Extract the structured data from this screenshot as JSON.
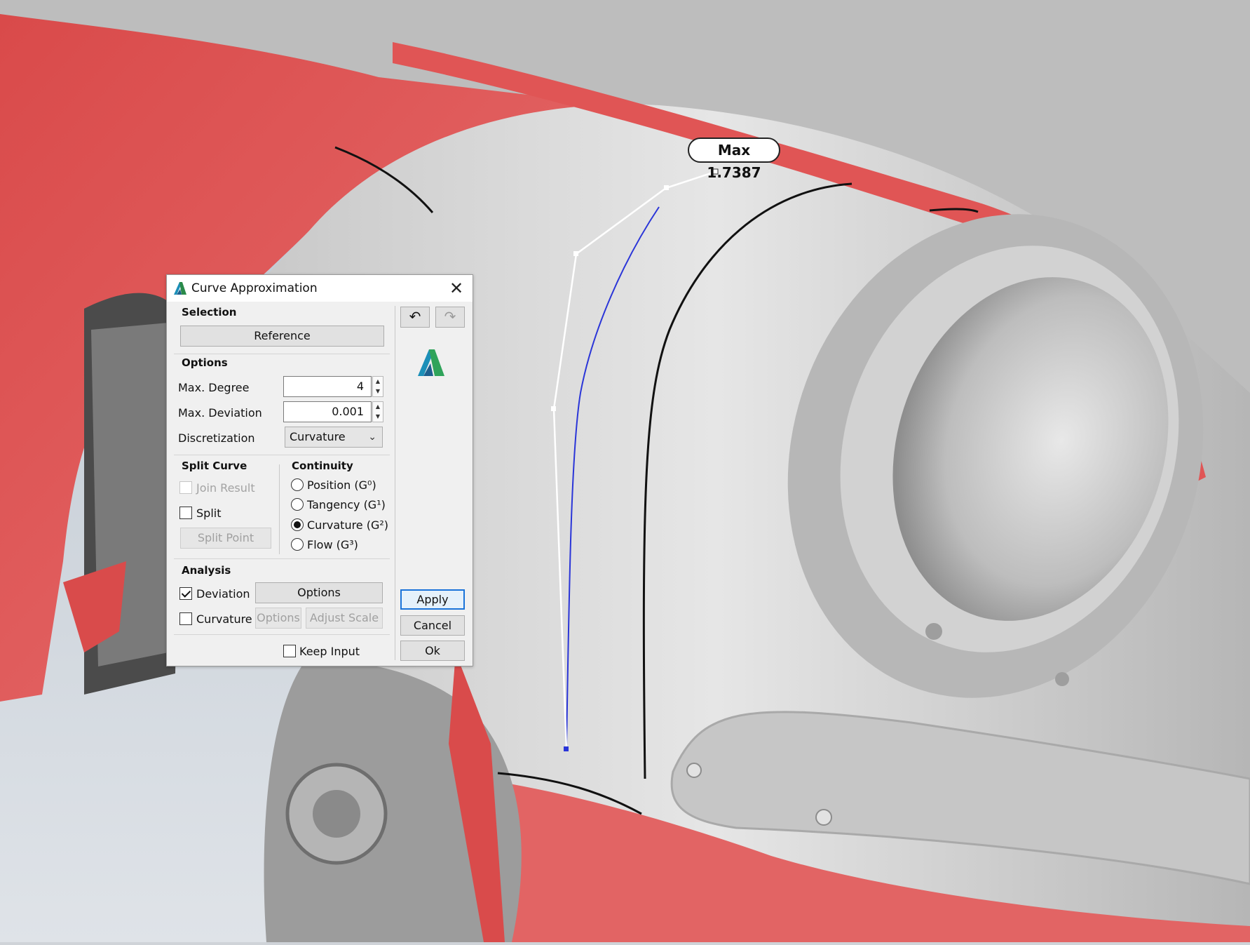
{
  "viewport": {
    "annotation": "Max 1.7387",
    "accent_red": "#e04b4b",
    "surface_gray": "#c9c9c9"
  },
  "dialog": {
    "title": "Curve Approximation",
    "app_icon": "autodesk-logo-icon",
    "close_icon": "close-icon",
    "selection": {
      "title": "Selection",
      "reference_button": "Reference"
    },
    "options": {
      "title": "Options",
      "max_degree_label": "Max. Degree",
      "max_degree_value": "4",
      "max_deviation_label": "Max. Deviation",
      "max_deviation_value": "0.001",
      "discretization_label": "Discretization",
      "discretization_value": "Curvature"
    },
    "split_curve": {
      "title": "Split Curve",
      "join_result": "Join Result",
      "split": "Split",
      "split_point": "Split Point"
    },
    "continuity": {
      "title": "Continuity",
      "position": "Position (G⁰)",
      "tangency": "Tangency (G¹)",
      "curvature": "Curvature (G²)",
      "flow": "Flow (G³)",
      "selected": "curvature"
    },
    "analysis": {
      "title": "Analysis",
      "deviation": "Deviation",
      "deviation_checked": true,
      "deviation_options": "Options",
      "curvature": "Curvature",
      "curvature_options": "Options",
      "adjust_scale": "Adjust Scale"
    },
    "keep_input": "Keep Input",
    "undo_icon": "undo-icon",
    "redo_icon": "redo-icon",
    "apply": "Apply",
    "cancel": "Cancel",
    "ok": "Ok"
  }
}
